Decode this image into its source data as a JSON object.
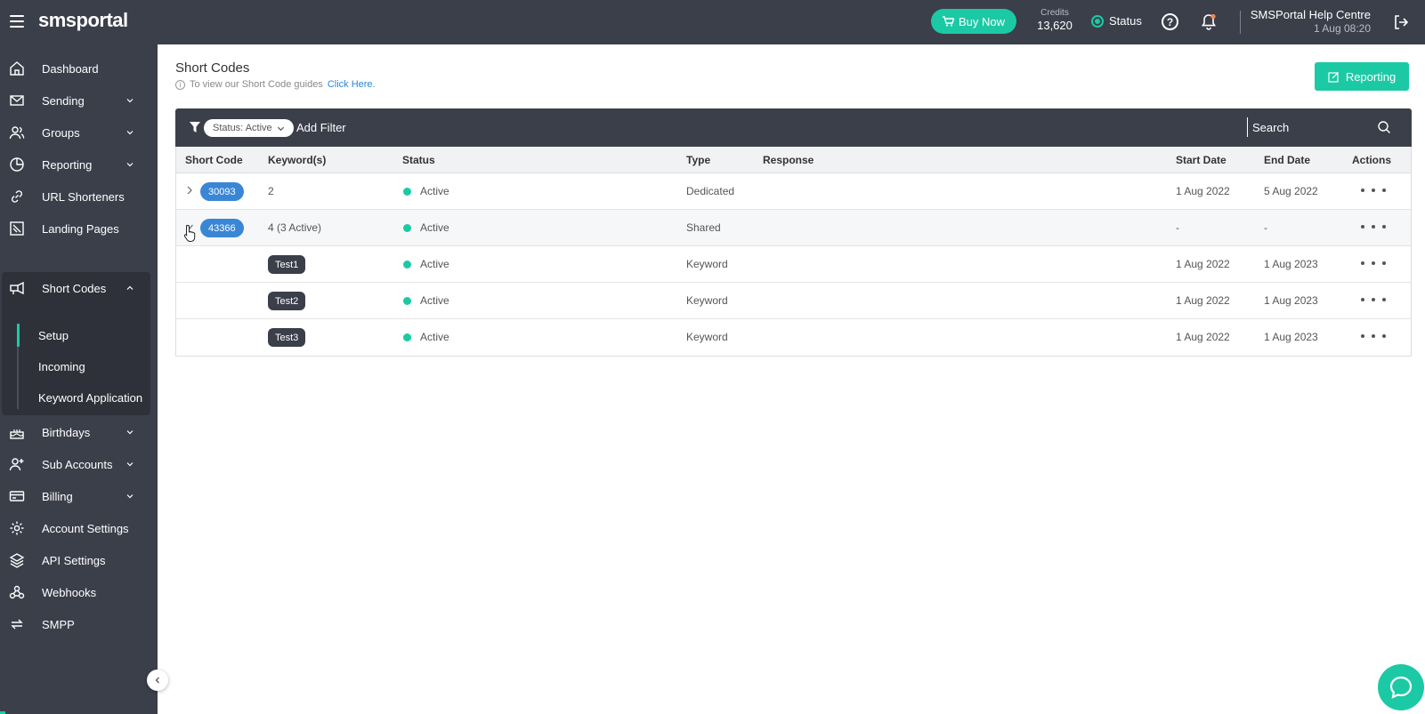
{
  "header": {
    "logo": "smsportal",
    "buy_now": "Buy Now",
    "credits_label": "Credits",
    "credits_value": "13,620",
    "status_label": "Status",
    "help_symbol": "?",
    "user_name": "SMSPortal Help Centre",
    "user_time": "1 Aug 08:20"
  },
  "sidebar": {
    "items": [
      {
        "label": "Dashboard",
        "icon": "home-icon"
      },
      {
        "label": "Sending",
        "icon": "envelope-icon"
      },
      {
        "label": "Groups",
        "icon": "users-icon"
      },
      {
        "label": "Reporting",
        "icon": "pie-chart-icon"
      },
      {
        "label": "URL Shorteners",
        "icon": "link-icon"
      },
      {
        "label": "Landing Pages",
        "icon": "landing-page-icon"
      },
      {
        "label": "Short Codes",
        "icon": "megaphone-icon"
      },
      {
        "label": "Birthdays",
        "icon": "cake-icon"
      },
      {
        "label": "Sub Accounts",
        "icon": "user-plus-icon"
      },
      {
        "label": "Billing",
        "icon": "credit-card-icon"
      },
      {
        "label": "Account Settings",
        "icon": "gear-icon"
      },
      {
        "label": "API Settings",
        "icon": "layers-icon"
      },
      {
        "label": "Webhooks",
        "icon": "webhook-icon"
      },
      {
        "label": "SMPP",
        "icon": "sync-icon"
      }
    ],
    "short_codes_sub": [
      "Setup",
      "Incoming",
      "Keyword Application"
    ]
  },
  "page": {
    "title": "Short Codes",
    "guide_text": "To view our Short Code guides",
    "guide_link": "Click Here.",
    "reporting_button": "Reporting"
  },
  "filter": {
    "chip": "Status: Active",
    "add_filter": "Add Filter",
    "search_placeholder": "Search"
  },
  "table": {
    "columns": [
      "Short Code",
      "Keyword(s)",
      "Status",
      "Type",
      "Response",
      "Start Date",
      "End Date",
      "Actions"
    ],
    "rows": [
      {
        "code": "30093",
        "keywords": "2",
        "status": "Active",
        "type": "Dedicated",
        "response": "",
        "start": "1 Aug 2022",
        "end": "5 Aug 2022"
      },
      {
        "code": "43366",
        "keywords": "4 (3 Active)",
        "status": "Active",
        "type": "Shared",
        "response": "",
        "start": "-",
        "end": "-"
      },
      {
        "keyword": "Test1",
        "status": "Active",
        "type": "Keyword",
        "response": "",
        "start": "1 Aug 2022",
        "end": "1 Aug 2023"
      },
      {
        "keyword": "Test2",
        "status": "Active",
        "type": "Keyword",
        "response": "",
        "start": "1 Aug 2022",
        "end": "1 Aug 2023"
      },
      {
        "keyword": "Test3",
        "status": "Active",
        "type": "Keyword",
        "response": "",
        "start": "1 Aug 2022",
        "end": "1 Aug 2023"
      }
    ]
  },
  "colors": {
    "sidebar_bg": "#3b3f4a",
    "accent": "#1cc9a5",
    "code_pill": "#3a86d6"
  }
}
